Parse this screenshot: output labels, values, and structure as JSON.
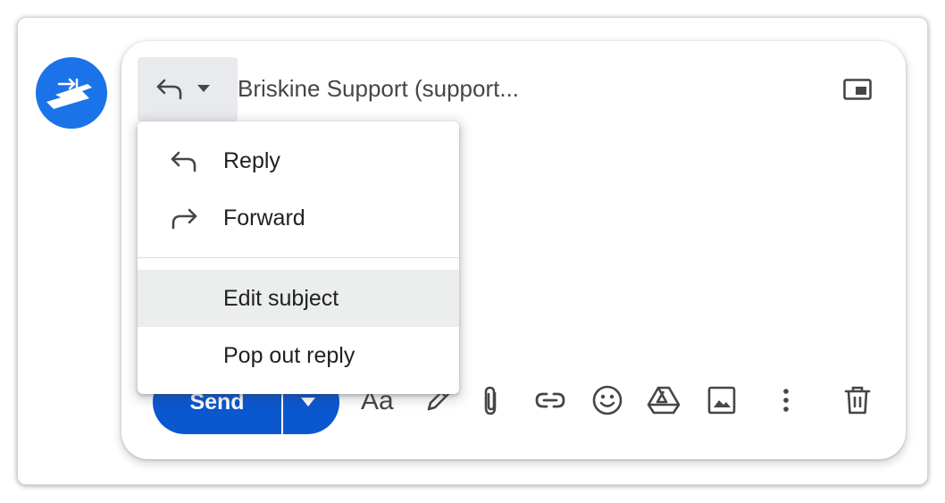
{
  "compose": {
    "recipient": "Briskine Support (support...",
    "send_label": "Send",
    "format_label": "Aa"
  },
  "menu": {
    "items": [
      {
        "label": "Reply",
        "icon": "reply-icon"
      },
      {
        "label": "Forward",
        "icon": "forward-icon"
      },
      {
        "label": "Edit subject",
        "icon": ""
      },
      {
        "label": "Pop out reply",
        "icon": ""
      }
    ]
  },
  "toolbar_icons": [
    "format-text-icon",
    "pen-icon",
    "attachment-icon",
    "link-icon",
    "emoji-icon",
    "drive-icon",
    "image-icon",
    "more-options-icon",
    "delete-icon"
  ],
  "colors": {
    "accent": "#1a73e8",
    "send": "#0b57d0",
    "icon": "#444746",
    "menu_hover": "#eceeed"
  }
}
